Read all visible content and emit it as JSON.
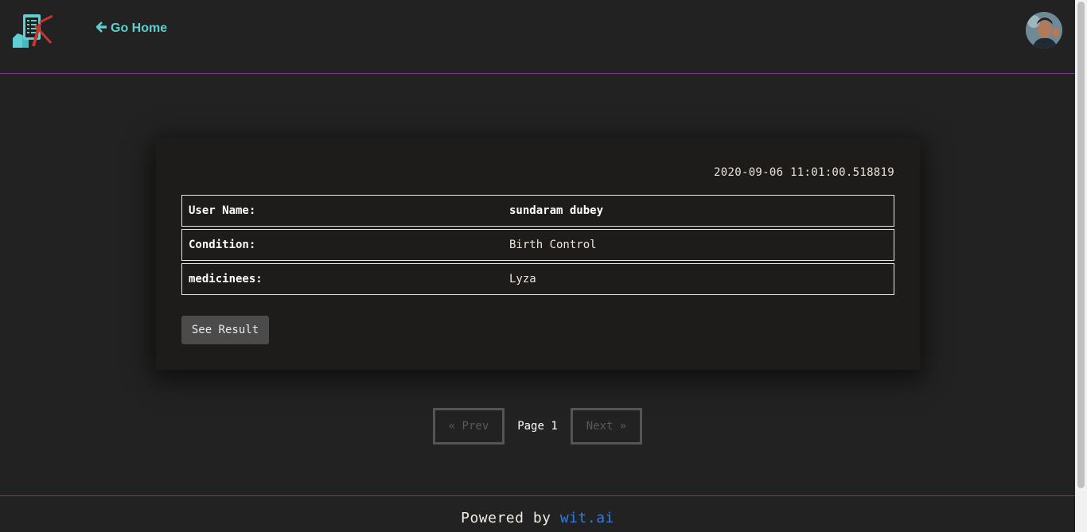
{
  "header": {
    "logo_icon": "clipboard-hand-logo-icon",
    "go_home_icon": "arrow-left-icon",
    "go_home_label": "Go Home",
    "avatar_icon": "user-avatar"
  },
  "record": {
    "timestamp": "2020-09-06 11:01:00.518819",
    "rows": [
      {
        "key": "User Name:",
        "value": "sundaram dubey"
      },
      {
        "key": "Condition:",
        "value": "Birth Control"
      },
      {
        "key": "medicinees:",
        "value": "Lyza"
      }
    ],
    "see_result_label": "See Result"
  },
  "pagination": {
    "prev_label": "« Prev",
    "page_label": "Page 1",
    "next_label": "Next »"
  },
  "footer": {
    "powered_by": "Powered by",
    "link_text": "wit.ai"
  },
  "colors": {
    "background": "#222222",
    "accent_teal": "#5ecfd3",
    "divider_purple": "#6b3f86",
    "link_blue": "#2f7de8"
  }
}
